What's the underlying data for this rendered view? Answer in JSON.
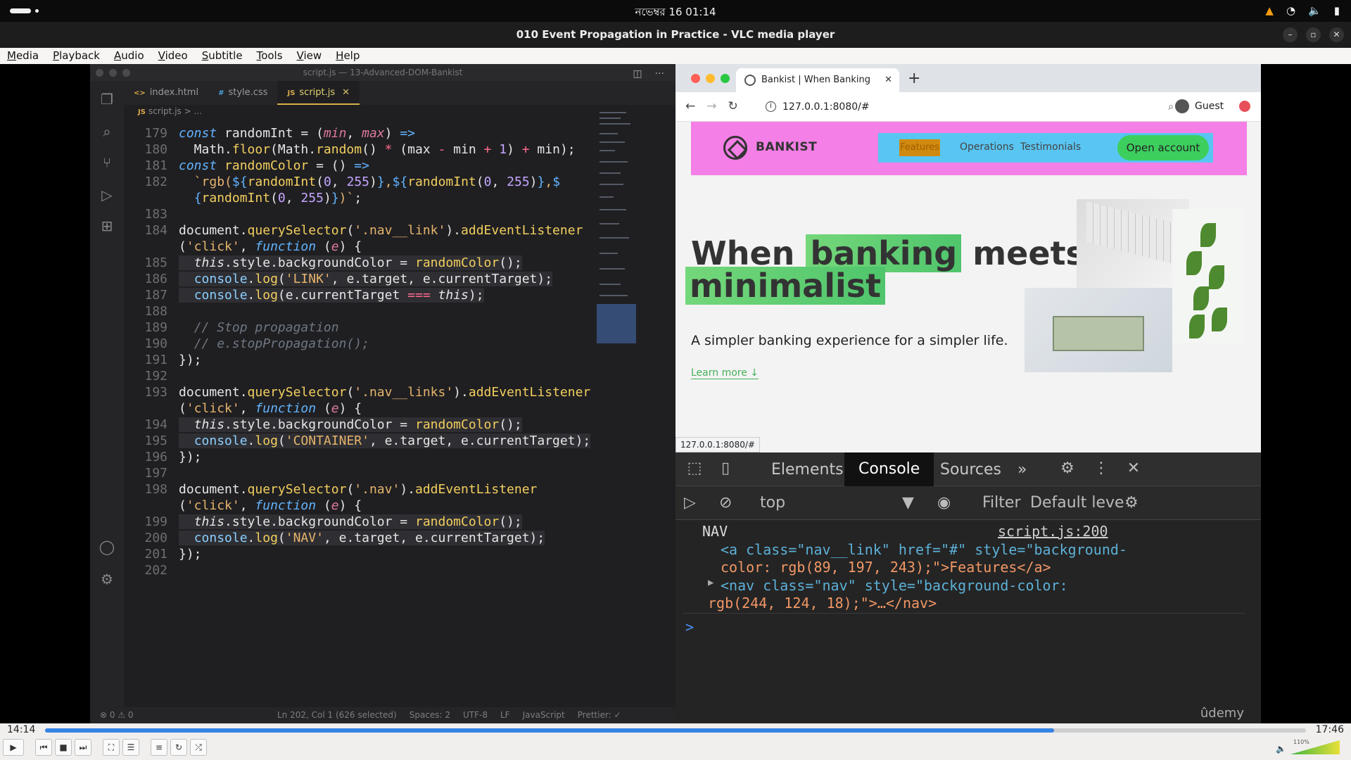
{
  "system": {
    "clock": "নভেম্বর 16  01:14",
    "tray_icons": [
      "vlc-cone-icon",
      "wifi-icon",
      "volume-icon",
      "battery-icon"
    ]
  },
  "vlc": {
    "window_title": "010 Event Propagation in Practice - VLC media player",
    "menu": [
      "Media",
      "Playback",
      "Audio",
      "Video",
      "Subtitle",
      "Tools",
      "View",
      "Help"
    ],
    "elapsed": "14:14",
    "total": "17:46",
    "progress_fraction": 0.8,
    "volume_label": "110%"
  },
  "vscode": {
    "title": "script.js — 13-Advanced-DOM-Bankist",
    "tabs": [
      {
        "type": "<>",
        "label": "index.html"
      },
      {
        "type": "#",
        "label": "style.css"
      },
      {
        "type": "JS",
        "label": "script.js",
        "close": "✕"
      }
    ],
    "breadcrumb": "script.js > ...",
    "breadcrumb_type": "JS",
    "status": {
      "problems": "⊗ 0 ⚠ 0",
      "position": "Ln 202, Col 1 (626 selected)",
      "spaces": "Spaces: 2",
      "encoding": "UTF-8",
      "eol": "LF",
      "language": "JavaScript",
      "formatter": "Prettier: ✓"
    },
    "line_numbers": [
      "179",
      "180",
      "181",
      "182",
      "",
      "183",
      "184",
      "",
      "185",
      "186",
      "187",
      "188",
      "189",
      "190",
      "191",
      "192",
      "193",
      "",
      "194",
      "195",
      "196",
      "197",
      "198",
      "",
      "199",
      "200",
      "201",
      "202"
    ]
  },
  "browser": {
    "tab_title": "Bankist | When Banking meets",
    "tab_close": "✕",
    "new_tab": "+",
    "url": "127.0.0.1:8080/#",
    "profile": "Guest",
    "status_url": "127.0.0.1:8080/#",
    "page": {
      "logo": "BANKIST",
      "nav": [
        "Features",
        "Operations",
        "Testimonials"
      ],
      "cta": "Open account",
      "hero_word1": "When",
      "hero_highlight1": "banking",
      "hero_word2": "meets",
      "hero_highlight2": "minimalist",
      "subtitle": "A simpler banking experience for a simpler life.",
      "learn_more": "Learn more ↓",
      "colors": {
        "header_bg": "#f47fe6",
        "nav_bg": "#59c5f3",
        "feature_bg": "#d08a0f",
        "cta": "#3ccf5e"
      }
    }
  },
  "devtools": {
    "tabs": [
      "Elements",
      "Console",
      "Sources"
    ],
    "more": "»",
    "context": "top",
    "filter_placeholder": "Filter",
    "levels": "Default leve",
    "log_label": "NAV",
    "log_source": "script.js:200",
    "line1": "<a class=\"nav__link\" href=\"#\" style=\"background-",
    "line2": "color: rgb(89, 197, 243);\">Features</a>",
    "line3": "<nav class=\"nav\" style=\"background-color:",
    "line4": "rgb(244, 124, 18);\">…</nav>",
    "prompt": ">",
    "watermark": "ûdemy"
  }
}
